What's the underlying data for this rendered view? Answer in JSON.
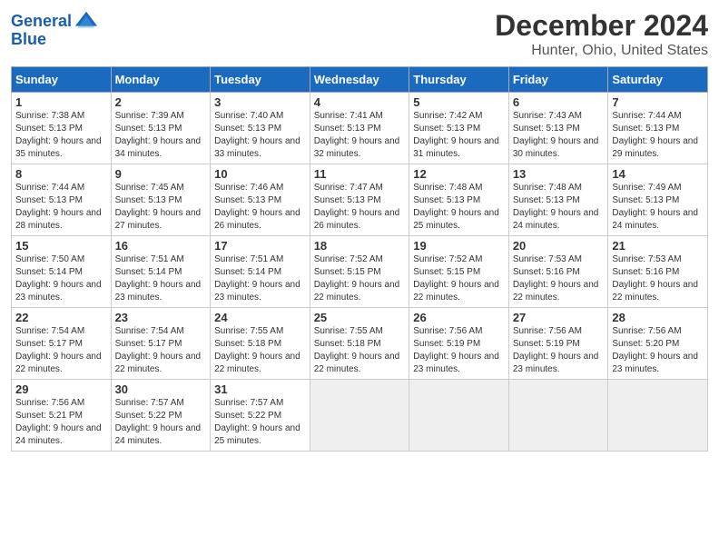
{
  "header": {
    "logo_line1": "General",
    "logo_line2": "Blue",
    "month": "December 2024",
    "location": "Hunter, Ohio, United States"
  },
  "days_of_week": [
    "Sunday",
    "Monday",
    "Tuesday",
    "Wednesday",
    "Thursday",
    "Friday",
    "Saturday"
  ],
  "weeks": [
    [
      {
        "day": 1,
        "sunrise": "7:38 AM",
        "sunset": "5:13 PM",
        "daylight": "9 hours and 35 minutes."
      },
      {
        "day": 2,
        "sunrise": "7:39 AM",
        "sunset": "5:13 PM",
        "daylight": "9 hours and 34 minutes."
      },
      {
        "day": 3,
        "sunrise": "7:40 AM",
        "sunset": "5:13 PM",
        "daylight": "9 hours and 33 minutes."
      },
      {
        "day": 4,
        "sunrise": "7:41 AM",
        "sunset": "5:13 PM",
        "daylight": "9 hours and 32 minutes."
      },
      {
        "day": 5,
        "sunrise": "7:42 AM",
        "sunset": "5:13 PM",
        "daylight": "9 hours and 31 minutes."
      },
      {
        "day": 6,
        "sunrise": "7:43 AM",
        "sunset": "5:13 PM",
        "daylight": "9 hours and 30 minutes."
      },
      {
        "day": 7,
        "sunrise": "7:44 AM",
        "sunset": "5:13 PM",
        "daylight": "9 hours and 29 minutes."
      }
    ],
    [
      {
        "day": 8,
        "sunrise": "7:44 AM",
        "sunset": "5:13 PM",
        "daylight": "9 hours and 28 minutes."
      },
      {
        "day": 9,
        "sunrise": "7:45 AM",
        "sunset": "5:13 PM",
        "daylight": "9 hours and 27 minutes."
      },
      {
        "day": 10,
        "sunrise": "7:46 AM",
        "sunset": "5:13 PM",
        "daylight": "9 hours and 26 minutes."
      },
      {
        "day": 11,
        "sunrise": "7:47 AM",
        "sunset": "5:13 PM",
        "daylight": "9 hours and 26 minutes."
      },
      {
        "day": 12,
        "sunrise": "7:48 AM",
        "sunset": "5:13 PM",
        "daylight": "9 hours and 25 minutes."
      },
      {
        "day": 13,
        "sunrise": "7:48 AM",
        "sunset": "5:13 PM",
        "daylight": "9 hours and 24 minutes."
      },
      {
        "day": 14,
        "sunrise": "7:49 AM",
        "sunset": "5:13 PM",
        "daylight": "9 hours and 24 minutes."
      }
    ],
    [
      {
        "day": 15,
        "sunrise": "7:50 AM",
        "sunset": "5:14 PM",
        "daylight": "9 hours and 23 minutes."
      },
      {
        "day": 16,
        "sunrise": "7:51 AM",
        "sunset": "5:14 PM",
        "daylight": "9 hours and 23 minutes."
      },
      {
        "day": 17,
        "sunrise": "7:51 AM",
        "sunset": "5:14 PM",
        "daylight": "9 hours and 23 minutes."
      },
      {
        "day": 18,
        "sunrise": "7:52 AM",
        "sunset": "5:15 PM",
        "daylight": "9 hours and 22 minutes."
      },
      {
        "day": 19,
        "sunrise": "7:52 AM",
        "sunset": "5:15 PM",
        "daylight": "9 hours and 22 minutes."
      },
      {
        "day": 20,
        "sunrise": "7:53 AM",
        "sunset": "5:16 PM",
        "daylight": "9 hours and 22 minutes."
      },
      {
        "day": 21,
        "sunrise": "7:53 AM",
        "sunset": "5:16 PM",
        "daylight": "9 hours and 22 minutes."
      }
    ],
    [
      {
        "day": 22,
        "sunrise": "7:54 AM",
        "sunset": "5:17 PM",
        "daylight": "9 hours and 22 minutes."
      },
      {
        "day": 23,
        "sunrise": "7:54 AM",
        "sunset": "5:17 PM",
        "daylight": "9 hours and 22 minutes."
      },
      {
        "day": 24,
        "sunrise": "7:55 AM",
        "sunset": "5:18 PM",
        "daylight": "9 hours and 22 minutes."
      },
      {
        "day": 25,
        "sunrise": "7:55 AM",
        "sunset": "5:18 PM",
        "daylight": "9 hours and 22 minutes."
      },
      {
        "day": 26,
        "sunrise": "7:56 AM",
        "sunset": "5:19 PM",
        "daylight": "9 hours and 23 minutes."
      },
      {
        "day": 27,
        "sunrise": "7:56 AM",
        "sunset": "5:19 PM",
        "daylight": "9 hours and 23 minutes."
      },
      {
        "day": 28,
        "sunrise": "7:56 AM",
        "sunset": "5:20 PM",
        "daylight": "9 hours and 23 minutes."
      }
    ],
    [
      {
        "day": 29,
        "sunrise": "7:56 AM",
        "sunset": "5:21 PM",
        "daylight": "9 hours and 24 minutes."
      },
      {
        "day": 30,
        "sunrise": "7:57 AM",
        "sunset": "5:22 PM",
        "daylight": "9 hours and 24 minutes."
      },
      {
        "day": 31,
        "sunrise": "7:57 AM",
        "sunset": "5:22 PM",
        "daylight": "9 hours and 25 minutes."
      },
      null,
      null,
      null,
      null
    ]
  ]
}
